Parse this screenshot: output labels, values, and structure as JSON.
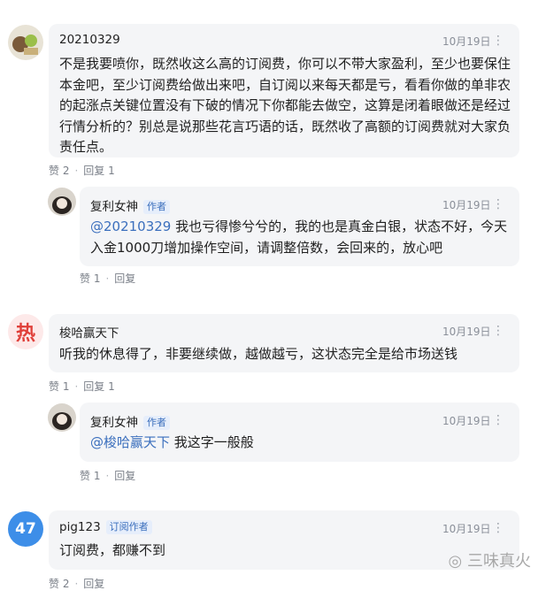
{
  "comments": [
    {
      "user": "20210329",
      "time": "10月19日",
      "text": "不是我要喷你，既然收这么高的订阅费，你可以不带大家盈利，至少也要保住本金吧，至少订阅费给做出来吧，自订阅以来每天都是亏，看看你做的单非农的起涨点关键位置没有下破的情况下你都能去做空，这算是闭着眼做还是经过行情分析的？别总是说那些花言巧语的话，既然收了高额的订阅费就对大家负责任点。",
      "likes": "赞 2",
      "reply_label": "回复 1",
      "reply": {
        "user": "复利女神",
        "badge": "作者",
        "time": "10月19日",
        "mention": "@20210329",
        "text": " 我也亏得惨兮兮的，我的也是真金白银，状态不好，今天入金1000刀增加操作空间，请调整倍数，会回来的，放心吧",
        "likes": "赞 1",
        "reply_label": "回复"
      }
    },
    {
      "user": "梭哈赢天下",
      "avatar_text": "热",
      "time": "10月19日",
      "text": "听我的休息得了，非要继续做，越做越亏，这状态完全是给市场送钱",
      "likes": "赞 1",
      "reply_label": "回复 1",
      "reply": {
        "user": "复利女神",
        "badge": "作者",
        "time": "10月19日",
        "mention": "@梭哈赢天下",
        "text": " 我这字一般般",
        "likes": "赞 1",
        "reply_label": "回复"
      }
    },
    {
      "user": "pig123",
      "badge": "订阅作者",
      "avatar_text": "47",
      "time": "10月19日",
      "text": "订阅费，都赚不到",
      "likes": "赞 2",
      "reply_label": "回复"
    }
  ],
  "more_icon": "more-dots-icon",
  "watermark": "三味真火",
  "colors": {
    "link": "#3b6fbd",
    "bubble": "#f4f5f7",
    "muted": "#8a8f99"
  }
}
